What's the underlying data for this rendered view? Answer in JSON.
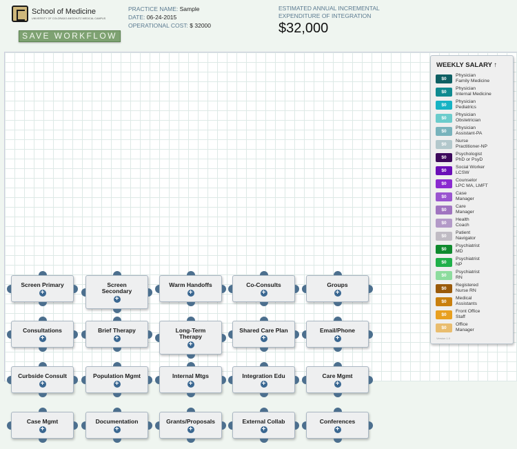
{
  "header": {
    "logo_title": "School of Medicine",
    "logo_subtitle": "UNIVERSITY OF COLORADO ANSCHUTZ MEDICAL CAMPUS",
    "save_label": "SAVE WORKFLOW",
    "practice_label": "PRACTICE NAME:",
    "practice_value": "Sample",
    "date_label": "DATE:",
    "date_value": "06-24-2015",
    "cost_label": "OPERATIONAL COST:",
    "cost_value": "$ 32000",
    "estimate_label_line1": "ESTIMATED ANNUAL INCREMENTAL",
    "estimate_label_line2": "EXPENDITURE OF INTEGRATION",
    "estimate_value": "$32,000"
  },
  "nodes": [
    {
      "label": "Screen Primary"
    },
    {
      "label": "Screen Secondary"
    },
    {
      "label": "Warm Handoffs"
    },
    {
      "label": "Co-Consults"
    },
    {
      "label": "Groups"
    },
    {
      "label": "Consultations"
    },
    {
      "label": "Brief Therapy"
    },
    {
      "label": "Long-Term Therapy"
    },
    {
      "label": "Shared Care Plan"
    },
    {
      "label": "Email/Phone"
    },
    {
      "label": "Curbside Consult"
    },
    {
      "label": "Population Mgmt"
    },
    {
      "label": "Internal Mtgs"
    },
    {
      "label": "Integration Edu"
    },
    {
      "label": "Care Mgmt"
    },
    {
      "label": "Case Mgmt"
    },
    {
      "label": "Documentation"
    },
    {
      "label": "Grants/Proposals"
    },
    {
      "label": "External Collab"
    },
    {
      "label": "Conferences"
    }
  ],
  "node_add_glyph": "+",
  "salary_panel": {
    "title": "WEEKLY SALARY ↑",
    "version": "Version 1.0",
    "items": [
      {
        "line1": "Physician",
        "line2": "Family Medicine",
        "value": "$0",
        "color": "#0d5f63"
      },
      {
        "line1": "Physician",
        "line2": "Internal Medicine",
        "value": "$0",
        "color": "#0f8a90"
      },
      {
        "line1": "Physician",
        "line2": "Pediatrics",
        "value": "$0",
        "color": "#17b3c4"
      },
      {
        "line1": "Physician",
        "line2": "Obstetrician",
        "value": "$0",
        "color": "#6bcccc"
      },
      {
        "line1": "Physician",
        "line2": "Assistant-PA",
        "value": "$0",
        "color": "#78b3bc"
      },
      {
        "line1": "Nurse",
        "line2": "Practitioner-NP",
        "value": "$0",
        "color": "#b3c8cc"
      },
      {
        "line1": "Psychologist",
        "line2": "PhD or PsyD",
        "value": "$0",
        "color": "#3d0a5c"
      },
      {
        "line1": "Social Worker",
        "line2": "LCSW",
        "value": "$0",
        "color": "#6b0fb8"
      },
      {
        "line1": "Counselor",
        "line2": "LPC MA, LMFT",
        "value": "$0",
        "color": "#8a2ad0"
      },
      {
        "line1": "Case",
        "line2": "Manager",
        "value": "$0",
        "color": "#9a55d0"
      },
      {
        "line1": "Care",
        "line2": "Manager",
        "value": "$0",
        "color": "#a074c0"
      },
      {
        "line1": "Health",
        "line2": "Coach",
        "value": "$0",
        "color": "#b39ac8"
      },
      {
        "line1": "Patient",
        "line2": "Navigator",
        "value": "$0",
        "color": "#c0bcc4"
      },
      {
        "line1": "Psychiatrist",
        "line2": "MD",
        "value": "$0",
        "color": "#0f8a2e"
      },
      {
        "line1": "Psychiatrist",
        "line2": "NP",
        "value": "$0",
        "color": "#20b04a"
      },
      {
        "line1": "Psychiatrist",
        "line2": "RN",
        "value": "$0",
        "color": "#8ddc9e"
      },
      {
        "line1": "Registered",
        "line2": "Nurse RN",
        "value": "$0",
        "color": "#9a5a0a"
      },
      {
        "line1": "Medical",
        "line2": "Assistants",
        "value": "$0",
        "color": "#c9800f"
      },
      {
        "line1": "Front Office",
        "line2": "Staff",
        "value": "$0",
        "color": "#e8a020"
      },
      {
        "line1": "Office",
        "line2": "Manager",
        "value": "$0",
        "color": "#e9bd6e"
      }
    ]
  }
}
